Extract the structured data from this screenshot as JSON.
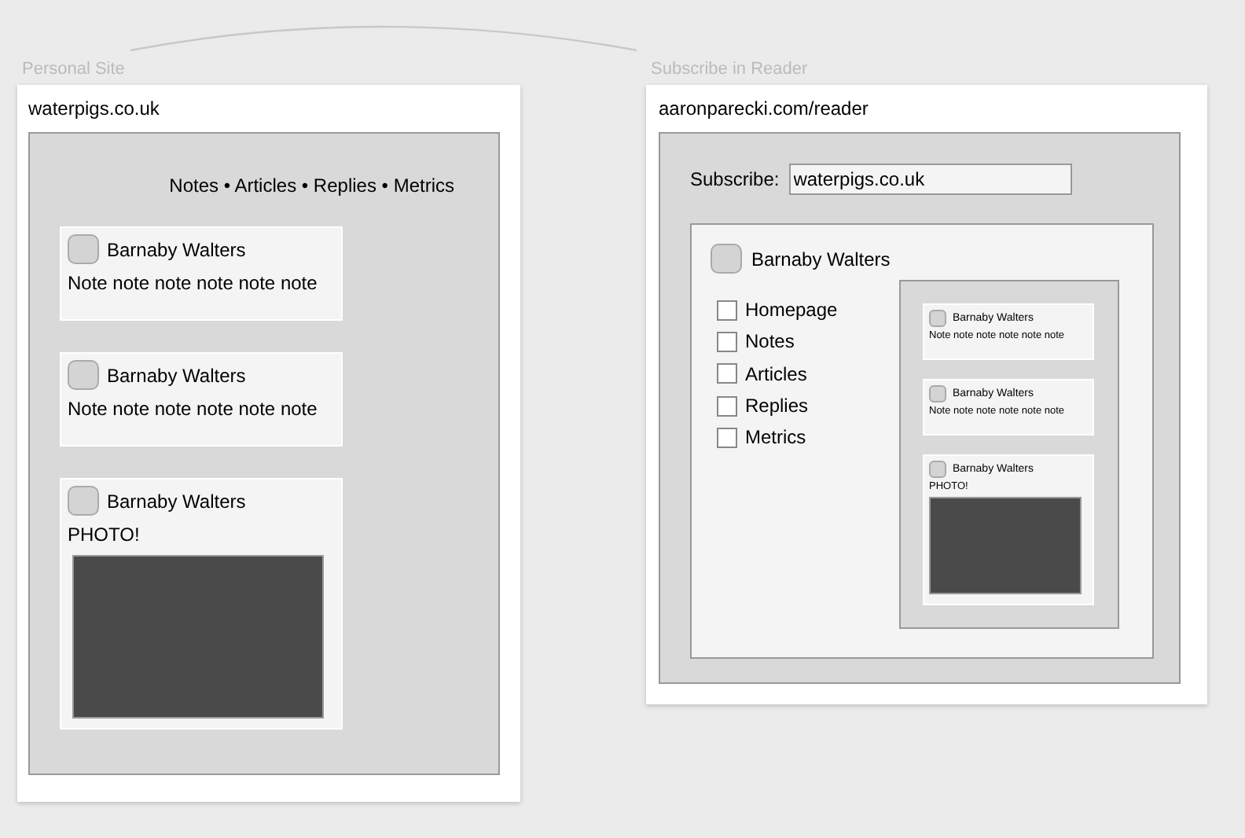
{
  "personal_site": {
    "label": "Personal Site",
    "url": "waterpigs.co.uk",
    "nav": "Notes • Articles • Replies • Metrics",
    "posts": [
      {
        "kind": "note",
        "author": "Barnaby Walters",
        "text": "Note note note note note note"
      },
      {
        "kind": "note",
        "author": "Barnaby Walters",
        "text": "Note note note note note note"
      },
      {
        "kind": "photo",
        "author": "Barnaby Walters",
        "text": "PHOTO!"
      }
    ]
  },
  "reader": {
    "label": "Subscribe in Reader",
    "url": "aaronparecki.com/reader",
    "subscribe_label": "Subscribe:",
    "subscribe_value": "waterpigs.co.uk",
    "author": "Barnaby Walters",
    "options": [
      {
        "label": "Homepage",
        "checked": false
      },
      {
        "label": "Notes",
        "checked": false
      },
      {
        "label": "Articles",
        "checked": false
      },
      {
        "label": "Replies",
        "checked": false
      },
      {
        "label": "Metrics",
        "checked": false
      }
    ],
    "preview_posts": [
      {
        "kind": "note",
        "author": "Barnaby Walters",
        "text": "Note note note note note note"
      },
      {
        "kind": "note",
        "author": "Barnaby Walters",
        "text": "Note note note note note note"
      },
      {
        "kind": "photo",
        "author": "Barnaby Walters",
        "text": "PHOTO!"
      }
    ]
  }
}
